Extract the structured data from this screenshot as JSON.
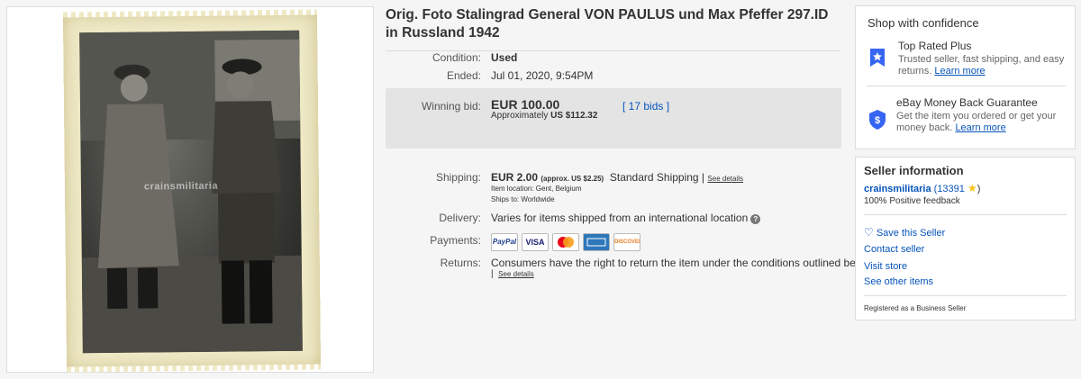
{
  "listing": {
    "title": "Orig. Foto Stalingrad General VON PAULUS und Max Pfeffer 297.ID in Russland 1942",
    "image_watermark": "crainsmilitaria"
  },
  "details": {
    "condition_label": "Condition:",
    "condition_value": "Used",
    "ended_label": "Ended:",
    "ended_value": "Jul 01, 2020, 9:54PM",
    "winning_bid_label": "Winning bid:",
    "winning_bid_value": "EUR 100.00",
    "approx_prefix": "Approximately",
    "approx_value": "US $112.32",
    "bids_link": "[ 17 bids ]",
    "shipping_label": "Shipping:",
    "shipping_cost": "EUR 2.00",
    "shipping_approx": "(approx. US $2.25)",
    "shipping_method": "Standard Shipping |",
    "shipping_details_link": "See details",
    "item_location": "Item location:  Gent, Belgium",
    "ships_to": "Ships to:  Worldwide",
    "delivery_label": "Delivery:",
    "delivery_value": "Varies for items shipped from an international location",
    "payments_label": "Payments:",
    "payment_methods": [
      "PayPal",
      "VISA",
      "Mastercard",
      "American Express",
      "DISCOVER"
    ],
    "returns_label": "Returns:",
    "returns_value": "Consumers have the right to return the item under the conditions outlined below",
    "returns_link": "See details"
  },
  "confidence": {
    "heading": "Shop with confidence",
    "top_rated_title": "Top Rated Plus",
    "top_rated_desc": "Trusted seller, fast shipping, and easy returns.",
    "top_rated_link": "Learn more",
    "guarantee_title": "eBay Money Back Guarantee",
    "guarantee_desc": "Get the item you ordered or get your money back.",
    "guarantee_link": "Learn more"
  },
  "seller": {
    "heading": "Seller information",
    "name": "crainsmilitaria",
    "feedback_score": "(13391",
    "feedback_close": ")",
    "positive": "100% Positive feedback",
    "save_seller": "Save this Seller",
    "contact": "Contact seller",
    "visit_store": "Visit store",
    "other_items": "See other items",
    "business": "Registered as a Business Seller"
  },
  "colors": {
    "link": "#0654ba",
    "bid_box": "#e4e4e4",
    "star": "#f5c518"
  }
}
